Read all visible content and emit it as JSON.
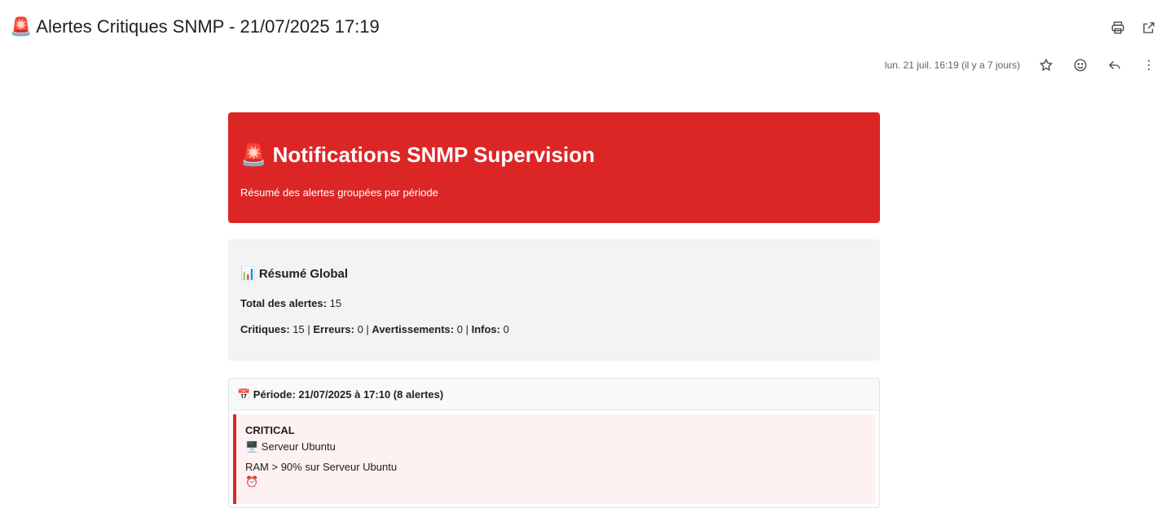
{
  "email": {
    "subject": "🚨 Alertes Critiques SNMP - 21/07/2025 17:19",
    "date": "lun. 21 juil. 16:19 (il y a 7 jours)",
    "icons": [
      "print-icon",
      "open-new-window-icon",
      "star-icon",
      "emoji-icon",
      "reply-icon",
      "more-options-icon"
    ]
  },
  "header": {
    "title": "🚨 Notifications SNMP Supervision",
    "subtitle": "Résumé des alertes groupées par période",
    "color": "#dc2626"
  },
  "summary": {
    "title": "📊 Résumé Global",
    "total_label": "Total des alertes:",
    "total_value": "15",
    "critical_label": "Critiques:",
    "critical_value": "15",
    "errors_label": "Erreurs:",
    "errors_value": "0",
    "warnings_label": "Avertissements:",
    "warnings_value": "0",
    "infos_label": "Infos:",
    "infos_value": "0",
    "separator": " | "
  },
  "periods": [
    {
      "title": "📅 Période: 21/07/2025 à 17:10 (8 alertes)",
      "alerts": [
        {
          "level": "CRITICAL",
          "host": "🖥️ Serveur Ubuntu",
          "message": "RAM > 90% sur Serveur Ubuntu",
          "time_icon": "⏰"
        }
      ]
    }
  ]
}
